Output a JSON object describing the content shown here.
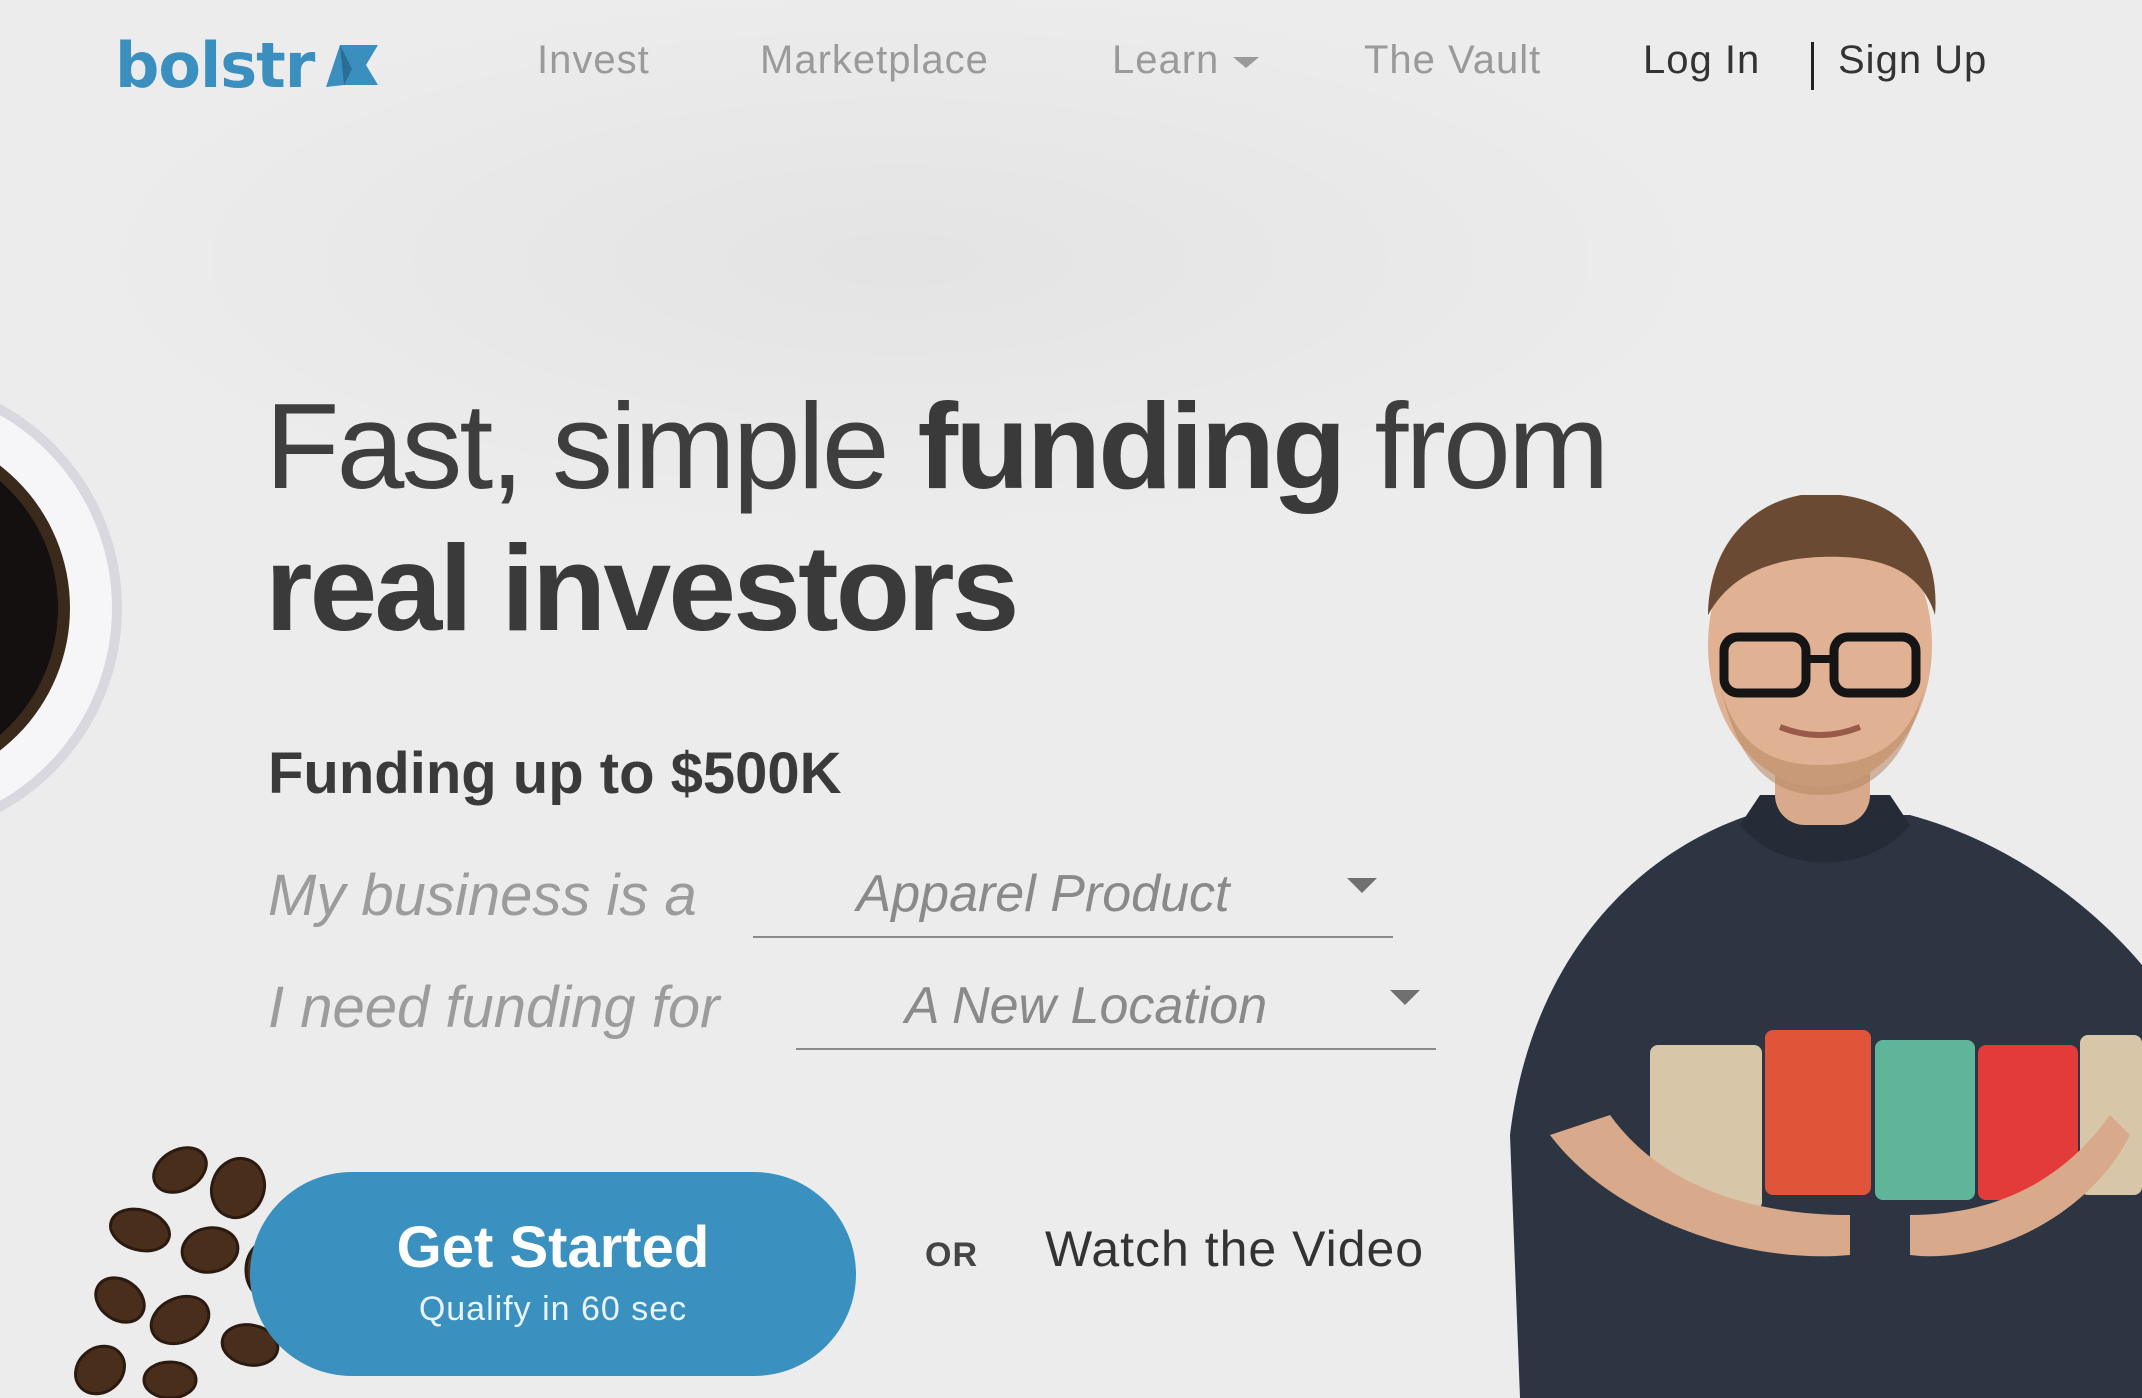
{
  "brand": {
    "name": "bolstr",
    "color": "#3b8fbe"
  },
  "nav": {
    "items": [
      {
        "label": "Invest"
      },
      {
        "label": "Marketplace"
      },
      {
        "label": "Learn",
        "has_dropdown": true
      },
      {
        "label": "The Vault"
      }
    ],
    "login": "Log In",
    "signup": "Sign Up"
  },
  "hero": {
    "headline_light_1": "Fast, simple ",
    "headline_bold_1": "funding",
    "headline_light_2": " from",
    "headline_bold_2": "real investors",
    "subhead": "Funding up to $500K",
    "business_label": "My business is a",
    "business_value": "Apparel Product",
    "funding_label": "I need funding for",
    "funding_value": "A New Location",
    "cta_title": "Get Started",
    "cta_subtitle": "Qualify in 60 sec",
    "or": "OR",
    "video_link": "Watch the Video"
  },
  "colors": {
    "accent": "#3a91c0",
    "background": "#ececec",
    "text": "#3a3a3a",
    "muted": "#9a9a9a"
  },
  "icons": [
    "logo-flag-icon",
    "chevron-down-icon",
    "coffee-cup-image",
    "coffee-beans-image",
    "person-with-coffee-bags-image"
  ]
}
